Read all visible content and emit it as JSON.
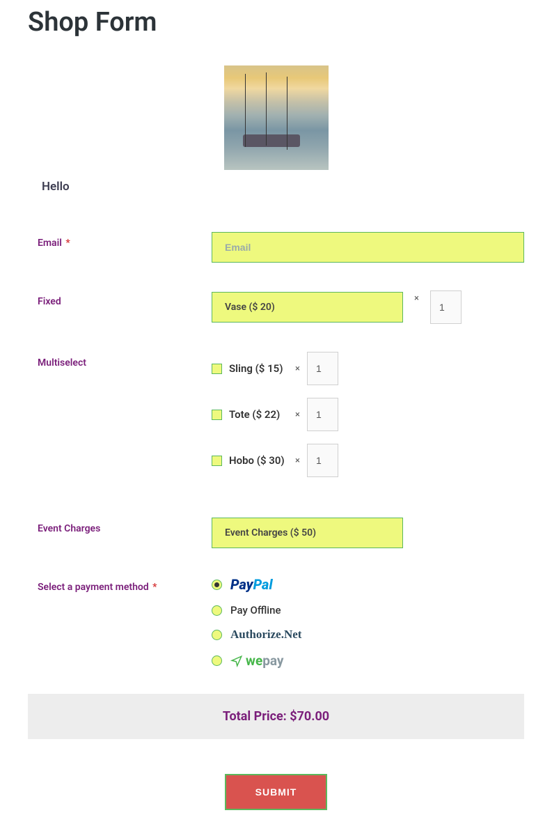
{
  "title": "Shop Form",
  "hello": "Hello",
  "email": {
    "label": "Email",
    "placeholder": "Email",
    "required": true
  },
  "fixed": {
    "label": "Fixed",
    "product": "Vase ($ 20)",
    "qty": "1"
  },
  "multiselect": {
    "label": "Multiselect",
    "items": [
      {
        "label": "Sling ($ 15)",
        "qty": "1"
      },
      {
        "label": "Tote ($ 22)",
        "qty": "1"
      },
      {
        "label": "Hobo ($ 30)",
        "qty": "1"
      }
    ]
  },
  "event_charges": {
    "label": "Event Charges",
    "value": "Event Charges ($ 50)"
  },
  "payment": {
    "label": "Select a payment method",
    "required": true,
    "options": {
      "paypal": "PayPal",
      "offline": "Pay Offline",
      "authorizenet": "Authorize.Net",
      "wepay": "wepay"
    },
    "selected": "paypal"
  },
  "total": {
    "label": "Total Price:",
    "amount": "$70.00"
  },
  "submit": "SUBMIT",
  "required_mark": "*"
}
